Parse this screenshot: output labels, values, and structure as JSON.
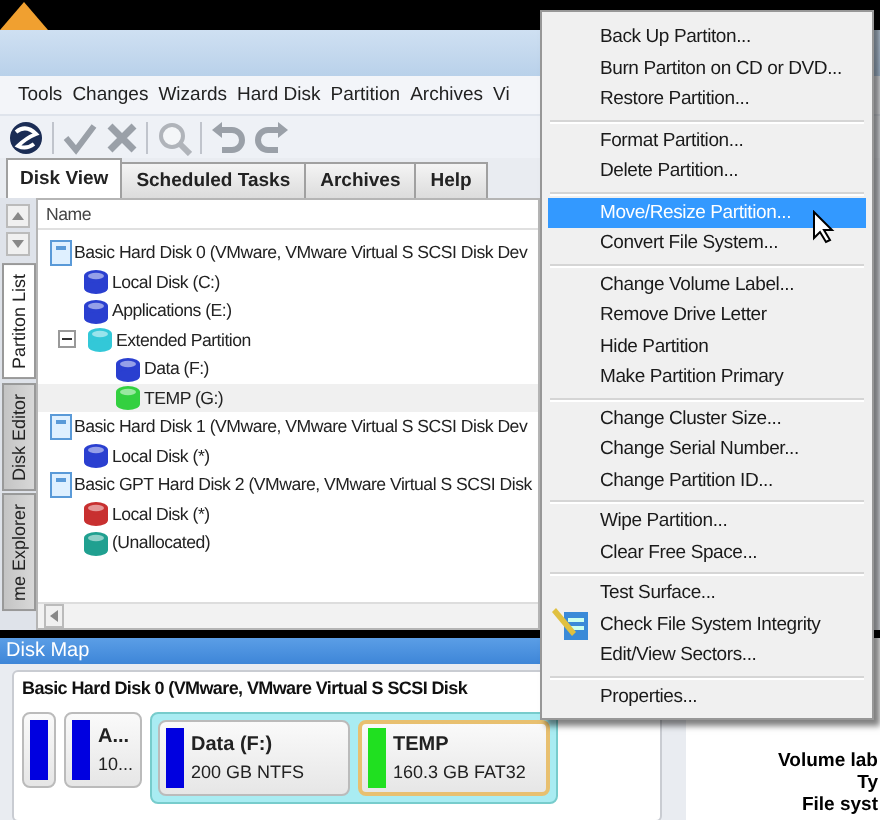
{
  "menu_bar": [
    "Tools",
    "Changes",
    "Wizards",
    "Hard Disk",
    "Partition",
    "Archives",
    "Vi"
  ],
  "tabs": [
    {
      "label": "Disk View",
      "selected": true
    },
    {
      "label": "Scheduled Tasks",
      "selected": false
    },
    {
      "label": "Archives",
      "selected": false
    },
    {
      "label": "Help",
      "selected": false
    }
  ],
  "side_tabs": [
    {
      "label": "Partiton List",
      "selected": true
    },
    {
      "label": "Disk Editor",
      "selected": false
    },
    {
      "label": "me Explorer",
      "selected": false
    }
  ],
  "tree": {
    "column": "Name",
    "items": [
      {
        "label": "Basic Hard Disk 0 (VMware, VMware Virtual S SCSI Disk Dev",
        "kind": "disk",
        "selected": false,
        "children": [
          {
            "label": "Local Disk (C:)",
            "kind": "volume",
            "color": "#2a3fd0",
            "selected": false
          },
          {
            "label": "Applications (E:)",
            "kind": "volume",
            "color": "#2a3fd0",
            "selected": false
          },
          {
            "label": "Extended Partition",
            "kind": "volume",
            "color": "#33c8d8",
            "selected": false,
            "expanded": true,
            "children": [
              {
                "label": "Data (F:)",
                "kind": "volume",
                "color": "#2a3fd0",
                "selected": false
              },
              {
                "label": "TEMP (G:)",
                "kind": "volume",
                "color": "#33d040",
                "selected": true
              }
            ]
          }
        ]
      },
      {
        "label": "Basic Hard Disk 1 (VMware, VMware Virtual S SCSI Disk Dev",
        "kind": "disk",
        "selected": false,
        "children": [
          {
            "label": "Local Disk (*)",
            "kind": "volume",
            "color": "#2a3fd0",
            "selected": false
          }
        ]
      },
      {
        "label": "Basic GPT Hard Disk 2 (VMware, VMware Virtual S SCSI Disk",
        "kind": "disk",
        "selected": false,
        "children": [
          {
            "label": "Local Disk (*)",
            "kind": "volume",
            "color": "#c83030",
            "selected": false
          },
          {
            "label": "(Unallocated)",
            "kind": "volume",
            "color": "#20a090",
            "selected": false
          }
        ]
      }
    ]
  },
  "disk_map": {
    "title": "Disk Map",
    "disk": "Basic Hard Disk 0 (VMware, VMware Virtual S SCSI Disk",
    "partitions": [
      {
        "color": "#0000e0",
        "extended": false
      },
      {
        "name": "A...",
        "size": "10...",
        "color": "#0000e0",
        "extended": false
      },
      {
        "name": "Data (F:)",
        "size": "200 GB NTFS",
        "color": "#0000e0",
        "extended": true
      },
      {
        "name": "TEMP",
        "size": "160.3 GB FAT32",
        "color": "#20e020",
        "extended": true
      }
    ]
  },
  "properties": [
    "Volume lab",
    "Ty",
    "File syst"
  ],
  "context_menu": [
    [
      {
        "label": "Back Up Partiton...",
        "kind": "item",
        "selected": false
      },
      {
        "label": "Burn Partiton on CD or DVD...",
        "kind": "item",
        "selected": false
      },
      {
        "label": "Restore Partition...",
        "kind": "item",
        "selected": false
      }
    ],
    [
      {
        "label": "Format Partition...",
        "kind": "item",
        "selected": false
      },
      {
        "label": "Delete Partition...",
        "kind": "item",
        "selected": false
      }
    ],
    [
      {
        "label": "Move/Resize Partition...",
        "kind": "item",
        "selected": true
      },
      {
        "label": "Convert File System...",
        "kind": "item",
        "selected": false
      }
    ],
    [
      {
        "label": "Change Volume Label...",
        "kind": "item",
        "selected": false
      },
      {
        "label": "Remove Drive Letter",
        "kind": "item",
        "selected": false
      },
      {
        "label": "Hide Partition",
        "kind": "item",
        "selected": false
      },
      {
        "label": "Make Partition Primary",
        "kind": "item",
        "selected": false
      }
    ],
    [
      {
        "label": "Change Cluster Size...",
        "kind": "item",
        "selected": false
      },
      {
        "label": "Change Serial Number...",
        "kind": "item",
        "selected": false
      },
      {
        "label": "Change Partition ID...",
        "kind": "item",
        "selected": false
      }
    ],
    [
      {
        "label": "Wipe Partition...",
        "kind": "item",
        "selected": false
      },
      {
        "label": "Clear Free Space...",
        "kind": "item",
        "selected": false
      }
    ],
    [
      {
        "label": "Test Surface...",
        "kind": "item",
        "selected": false
      },
      {
        "label": "Check File System Integrity",
        "kind": "icon-item",
        "selected": false
      },
      {
        "label": "Edit/View Sectors...",
        "kind": "item",
        "selected": false
      }
    ],
    [
      {
        "label": "Properties...",
        "kind": "item",
        "selected": false
      }
    ]
  ]
}
